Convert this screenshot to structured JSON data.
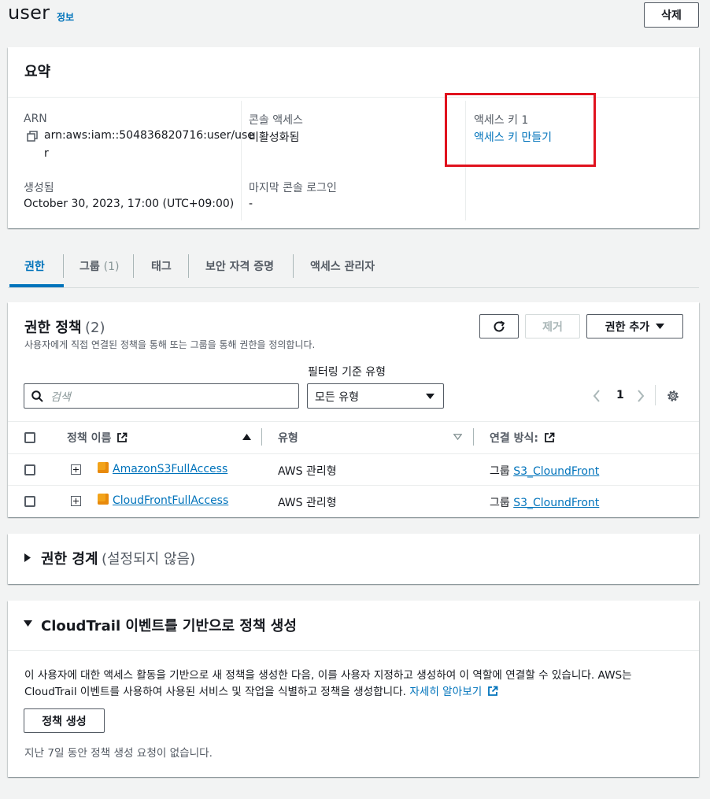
{
  "header": {
    "title": "user",
    "info_link": "정보",
    "delete_button": "삭제"
  },
  "summary": {
    "heading": "요약",
    "arn_label": "ARN",
    "arn_value_line1": "arn:aws:iam::504836820716:user/use",
    "arn_value_line2": "r",
    "created_label": "생성됨",
    "created_value": "October 30, 2023, 17:00 (UTC+09:00)",
    "console_access_label": "콘솔 액세스",
    "console_access_value": "비활성화됨",
    "last_login_label": "마지막 콘솔 로그인",
    "last_login_value": "-",
    "access_key_label": "액세스 키 1",
    "access_key_link": "액세스 키 만들기"
  },
  "tabs": [
    {
      "label": "권한"
    },
    {
      "label": "그룹",
      "count": "(1)"
    },
    {
      "label": "태그"
    },
    {
      "label": "보안 자격 증명"
    },
    {
      "label": "액세스 관리자"
    }
  ],
  "policies": {
    "heading": "권한 정책",
    "count": "(2)",
    "description": "사용자에게 직접 연결된 정책을 통해 또는 그룹을 통해 권한을 정의합니다.",
    "remove_button": "제거",
    "add_button": "권한 추가",
    "filter_label": "필터링 기준 유형",
    "search_placeholder": "검색",
    "filter_value": "모든 유형",
    "page": "1",
    "columns": {
      "name": "정책 이름",
      "type": "유형",
      "attached": "연결 방식:"
    },
    "rows": [
      {
        "name": "AmazonS3FullAccess",
        "type": "AWS 관리형",
        "attached_prefix": "그룹",
        "attached_link": "S3_CloundFront"
      },
      {
        "name": "CloudFrontFullAccess",
        "type": "AWS 관리형",
        "attached_prefix": "그룹",
        "attached_link": "S3_CloundFront"
      }
    ]
  },
  "boundary": {
    "heading": "권한 경계",
    "status": "(설정되지 않음)"
  },
  "cloudtrail": {
    "heading": "CloudTrail 이벤트를 기반으로 정책 생성",
    "body_line1": "이 사용자에 대한 액세스 활동을 기반으로 새 정책을 생성한 다음, 이를 사용자 지정하고 생성하여 이 역할에 연결할 수 있습니다. AWS는",
    "body_line2": "CloudTrail 이벤트를 사용하여 사용된 서비스 및 작업을 식별하고 정책을 생성합니다.",
    "learn_more": "자세히 알아보기",
    "generate_button": "정책 생성",
    "note": "지난 7일 동안 정책 생성 요청이 없습니다."
  },
  "colors": {
    "link": "#0073bb",
    "highlight_box": "#e0121e",
    "aws_managed_icon": "#f2a31a"
  }
}
